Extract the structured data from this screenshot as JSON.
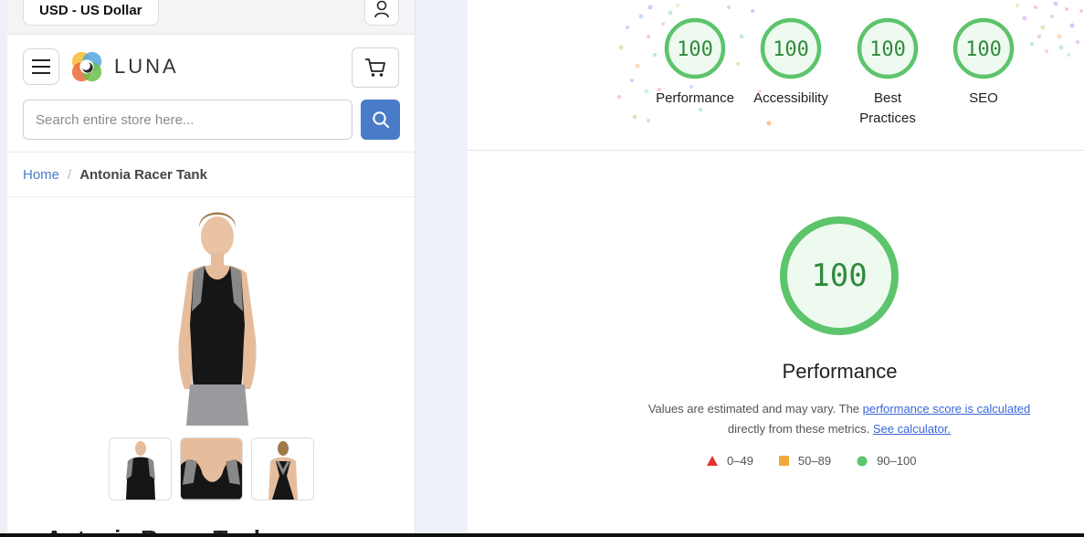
{
  "store": {
    "currency": "USD - US Dollar",
    "brand": "LUNA",
    "search_placeholder": "Search entire store here...",
    "breadcrumb": {
      "home": "Home",
      "separator": "/",
      "current": "Antonia Racer Tank"
    },
    "product_title_peek": "Antonia Racer Tank",
    "accent_color": "#4a7bc8"
  },
  "lighthouse": {
    "categories": [
      {
        "score": "100",
        "label": "Performance"
      },
      {
        "score": "100",
        "label": "Accessibility"
      },
      {
        "score": "100",
        "label": "Best Practices"
      },
      {
        "score": "100",
        "label": "SEO"
      }
    ],
    "main_score": "100",
    "main_title": "Performance",
    "desc_prefix": "Values are estimated and may vary. The ",
    "desc_link1": "performance score is calculated",
    "desc_middle": " directly from these metrics. ",
    "desc_link2": "See calculator.",
    "legend": [
      {
        "range": "0–49",
        "shape": "triangle",
        "color": "#e2342b"
      },
      {
        "range": "50–89",
        "shape": "square",
        "color": "#f2a83b"
      },
      {
        "range": "90–100",
        "shape": "circle",
        "color": "#5cc46b"
      }
    ],
    "pass_color": "#5cc46b",
    "pass_fill": "#eef9ef"
  },
  "icons": {
    "account": "user-icon",
    "menu": "hamburger-icon",
    "logo": "luna-logo-icon",
    "cart": "cart-icon",
    "search": "search-icon"
  }
}
